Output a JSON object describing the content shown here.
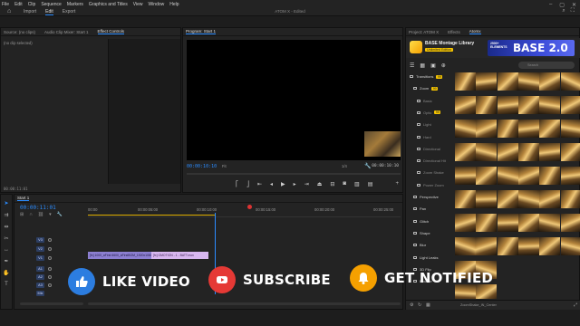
{
  "menubar": {
    "items": [
      "File",
      "Edit",
      "Clip",
      "Sequence",
      "Markers",
      "Graphics and Titles",
      "View",
      "Window",
      "Help"
    ],
    "title": "ATOM X - Edited"
  },
  "workspace": {
    "tabs": [
      "Import",
      "Edit",
      "Export"
    ],
    "active": "Edit"
  },
  "source_panel": {
    "tabs": [
      "Source: (no clips)",
      "Audio Clip Mixer: Start 1",
      "Effect Controls"
    ],
    "active": "Effect Controls",
    "empty_text": "(no clip selected)",
    "footer_time": "00:00:11:01"
  },
  "program_monitor": {
    "title": "Program: Start 1",
    "timecode": "00:00:10:10",
    "fit": "Fit",
    "quality": "1/4",
    "end_timecode": "00:00:10:10"
  },
  "timeline": {
    "title": "Start 1",
    "timecode": "00:00:11:01",
    "ruler": [
      "00:00",
      "00:00:05:00",
      "00:00:10:00",
      "00:00:15:00",
      "00:00:20:00",
      "00:00:25:00"
    ],
    "tracks": [
      "V3",
      "V2",
      "V1",
      "A1",
      "A2",
      "A3",
      "Mix"
    ],
    "clip_v1": "[fx] 1000_aFirst 6600_aFirstBGM_1920x1080.mp4 [V]",
    "clip_v2": "[fx] GMOTION - 1 - BATT.mov"
  },
  "plugin_panel": {
    "tabs": [
      "Project: ATOM X",
      "Effects",
      "Atomx"
    ],
    "active": "Atomx",
    "library_title": "BASE Montage Library",
    "badge": "Unlimited Edition",
    "brand": "BASE 2.0",
    "brand_sub": "2500+ ELEMENTS",
    "search_placeholder": "Search",
    "categories": [
      {
        "label": "Transitions",
        "count": "99",
        "level": 0
      },
      {
        "label": "Zoom",
        "count": "99",
        "level": 1
      },
      {
        "label": "Basic",
        "count": "",
        "level": 2
      },
      {
        "label": "Optic",
        "count": "99",
        "level": 2
      },
      {
        "label": "Light",
        "count": "",
        "level": 2
      },
      {
        "label": "Hard",
        "count": "",
        "level": 2
      },
      {
        "label": "Directional",
        "count": "",
        "level": 2
      },
      {
        "label": "Directional Hit",
        "count": "",
        "level": 2
      },
      {
        "label": "Zoom Shake",
        "count": "",
        "level": 2
      },
      {
        "label": "Power Zoom",
        "count": "",
        "level": 2
      },
      {
        "label": "Perspective",
        "count": "",
        "level": 1
      },
      {
        "label": "Pan",
        "count": "",
        "level": 1
      },
      {
        "label": "Glitch",
        "count": "",
        "level": 1
      },
      {
        "label": "Shape",
        "count": "",
        "level": 1
      },
      {
        "label": "Blur",
        "count": "",
        "level": 1
      },
      {
        "label": "Light Leaks",
        "count": "",
        "level": 1
      },
      {
        "label": "3D Flip",
        "count": "",
        "level": 1
      },
      {
        "label": "Bounce",
        "count": "",
        "level": 1
      }
    ],
    "footer_text": "ZoomShake_IN_Center"
  },
  "cta": {
    "like": "LIKE VIDEO",
    "subscribe": "SUBSCRIBE",
    "notify": "GET NOTIFIED"
  },
  "colors": {
    "accent": "#2b8cff",
    "like_circle": "#2c7de0",
    "subscribe_circle": "#e53935",
    "notify_circle": "#f5a000",
    "clip_v1": "#8c7fd1",
    "clip_v2": "#d8b7f0",
    "brand_yellow": "#f5c400"
  }
}
